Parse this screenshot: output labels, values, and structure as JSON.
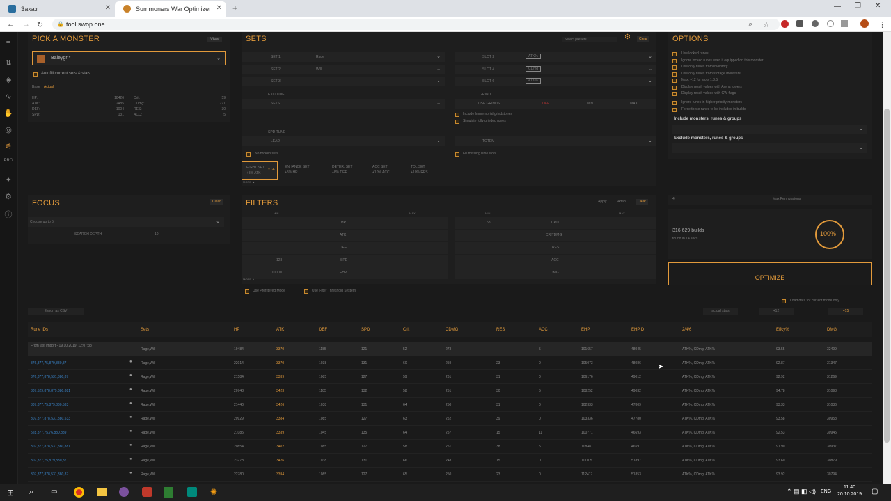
{
  "browser": {
    "tabs": [
      {
        "label": "Заказ"
      },
      {
        "label": "Summoners War Optimizer"
      }
    ],
    "url": "tool.swop.one"
  },
  "pick": {
    "title": "PICK A MONSTER",
    "view": "View",
    "monster": "Baleygr *",
    "autofill": "Autofill current sets & stats",
    "base": "Base",
    "actual": "Actual",
    "stats_left": [
      [
        "HP:",
        "18426"
      ],
      [
        "ATK:",
        "2485"
      ],
      [
        "DEF:",
        "1004"
      ],
      [
        "SPD:",
        "131"
      ]
    ],
    "stats_right": [
      [
        "Crit:",
        "59"
      ],
      [
        "CDmg:",
        "271"
      ],
      [
        "RES:",
        "30"
      ],
      [
        "ACC:",
        "5"
      ]
    ]
  },
  "sets": {
    "title": "SETS",
    "preset": "Select presets",
    "clear": "Clear",
    "left": [
      {
        "label": "SET 1",
        "value": "Rage"
      },
      {
        "label": "SET 2",
        "value": "Will"
      },
      {
        "label": "SET 3",
        "value": "-"
      }
    ],
    "right": [
      {
        "label": "SLOT 2",
        "value": "ATK%"
      },
      {
        "label": "SLOT 4",
        "value": "CDmg"
      },
      {
        "label": "SLOT 6",
        "value": "ATK%"
      }
    ],
    "exclude": "EXCLUDE",
    "sets_label": "SETS",
    "grind": "GRIND",
    "use_grinds": "USE GRINDS",
    "off": "OFF",
    "min": "MIN",
    "max": "MAX",
    "immemorial": "Include Immemorial grindstones",
    "simulate": "Simulate fully grinded runes",
    "spd_tune": "SPD TUNE",
    "lead": "LEAD",
    "lead_val": "-",
    "totem": "TOTEM",
    "totem_val": "-",
    "no_broken": "No broken sets",
    "fill_missing": "Fill missing rune slots",
    "setbuttons": [
      {
        "l1": "FIGHT SET",
        "l2": "+8% ATK",
        "badge": "x14"
      },
      {
        "l1": "ENHANCE SET",
        "l2": "+8% HP"
      },
      {
        "l1": "DETER. SET",
        "l2": "+8% DEF"
      },
      {
        "l1": "ACC SET",
        "l2": "+10% ACC"
      },
      {
        "l1": "TOL SET",
        "l2": "+10% RES"
      }
    ],
    "more": "MORE ▲"
  },
  "options": {
    "title": "OPTIONS",
    "items": [
      "Use locked runes",
      "Ignore locked runes even if equipped on this monster",
      "Use only runes from inventory",
      "Use only runes from storage monsters",
      "Max. +12 for slots 1,3,5",
      "Display result values with Arena towers",
      "Display result values with GW flags"
    ],
    "items2": [
      "Ignore runes in higher priority monsters",
      "Force these runes to be included in builds"
    ],
    "include": "Include monsters, runes & groups",
    "exclude": "Exclude monsters, runes & groups"
  },
  "focus": {
    "title": "FOCUS",
    "clear": "Clear",
    "choose": "Choose up to 5",
    "depth_label": "SEARCH DEPTH",
    "depth": "10"
  },
  "filters": {
    "title": "FILTERS",
    "apply": "Apply",
    "adapt": "Adapt",
    "clear": "Clear",
    "min": "MIN",
    "max": "MAX",
    "left": [
      {
        "min": "",
        "label": "HP"
      },
      {
        "min": "",
        "label": "ATK"
      },
      {
        "min": "",
        "label": "DEF"
      },
      {
        "min": "123",
        "label": "SPD"
      },
      {
        "min": "100000",
        "label": "EHP"
      }
    ],
    "right": [
      {
        "min": "58",
        "label": "CRIT"
      },
      {
        "min": "",
        "label": "CRITDMG"
      },
      {
        "min": "",
        "label": "RES"
      },
      {
        "min": "",
        "label": "ACC"
      },
      {
        "min": "",
        "label": "DMG"
      }
    ],
    "prefiltered": "Use Prefiltered Mode",
    "threshold": "Use Filter Threshold System",
    "more": "MORE ▲"
  },
  "optimize": {
    "max_perm": "Max Permutations",
    "builds": "316.629 builds",
    "found": "found in 14 secs.",
    "percent": "100%",
    "button": "OPTIMIZE",
    "n": "4",
    "load": "Load data for current mode only",
    "actual": "actual stats",
    "p12": "+12",
    "p15": "+15"
  },
  "table": {
    "export": "Export as CSV",
    "headers": [
      "Rune IDs",
      "Sets",
      "HP",
      "ATK",
      "DEF",
      "SPD",
      "Crit",
      "CDMG",
      "RES",
      "ACC",
      "EHP",
      "EHP D",
      "2/4/6",
      "Effcy%",
      "DMG"
    ],
    "rows": [
      [
        "From last import - 19.10.2019, 12:07:38",
        "Rage,Will",
        "19484",
        "3370",
        "1185",
        "121",
        "52",
        "273",
        "",
        "5",
        "101657",
        "48045",
        "ATK%, CDmg, ATK%",
        "93.55",
        "32499"
      ],
      [
        "876,877,75,879,880,87",
        "Rage,Will",
        "22014",
        "3370",
        "1038",
        "131",
        "60",
        "259",
        "23",
        "0",
        "105073",
        "48086",
        "ATK%, CDmg, ATK%",
        "92.87",
        "31347"
      ],
      [
        "876,877,878,531,880,87",
        "Rage,Will",
        "21584",
        "3339",
        "1085",
        "127",
        "59",
        "261",
        "31",
        "0",
        "106176",
        "49012",
        "ATK%, CDmg, ATK%",
        "92.92",
        "31269"
      ],
      [
        "307,529,878,879,880,881",
        "Rage,Will",
        "20748",
        "3423",
        "1185",
        "132",
        "58",
        "251",
        "30",
        "5",
        "108252",
        "49032",
        "ATK%, CDmg, ATK%",
        "94.78",
        "31098"
      ],
      [
        "307,877,75,879,880,533",
        "Rage,Will",
        "21440",
        "3426",
        "1038",
        "131",
        "64",
        "250",
        "31",
        "0",
        "102333",
        "47809",
        "ATK%, CDmg, ATK%",
        "93.33",
        "31036"
      ],
      [
        "307,877,878,531,880,533",
        "Rage,Will",
        "20929",
        "3384",
        "1085",
        "127",
        "63",
        "252",
        "39",
        "0",
        "103336",
        "47780",
        "ATK%, CDmg, ATK%",
        "93.58",
        "30958"
      ],
      [
        "528,877,75,76,880,889",
        "Rage,Will",
        "21085",
        "3339",
        "1045",
        "135",
        "64",
        "257",
        "15",
        "11",
        "100771",
        "46693",
        "ATK%, CDmg, ATK%",
        "92.53",
        "30945"
      ],
      [
        "307,877,878,531,880,881",
        "Rage,Will",
        "20854",
        "3402",
        "1085",
        "127",
        "58",
        "251",
        "38",
        "5",
        "108487",
        "46591",
        "ATK%, CDmg, ATK%",
        "91.90",
        "30937"
      ],
      [
        "307,877,75,879,880,87",
        "Rage,Will",
        "23278",
        "3426",
        "1038",
        "131",
        "66",
        "248",
        "15",
        "0",
        "111105",
        "51897",
        "ATK%, CDmg, ATK%",
        "93.60",
        "30879"
      ],
      [
        "307,877,878,531,880,87",
        "Rage,Will",
        "22780",
        "3394",
        "1085",
        "127",
        "65",
        "250",
        "23",
        "0",
        "112417",
        "51853",
        "ATK%, CDmg, ATK%",
        "93.92",
        "30794"
      ]
    ]
  },
  "taskbar": {
    "time": "11:40",
    "date": "20.10.2019",
    "lang": "ENG"
  },
  "colors": {
    "accent": "#e29a3b",
    "link": "#3a84c9"
  }
}
